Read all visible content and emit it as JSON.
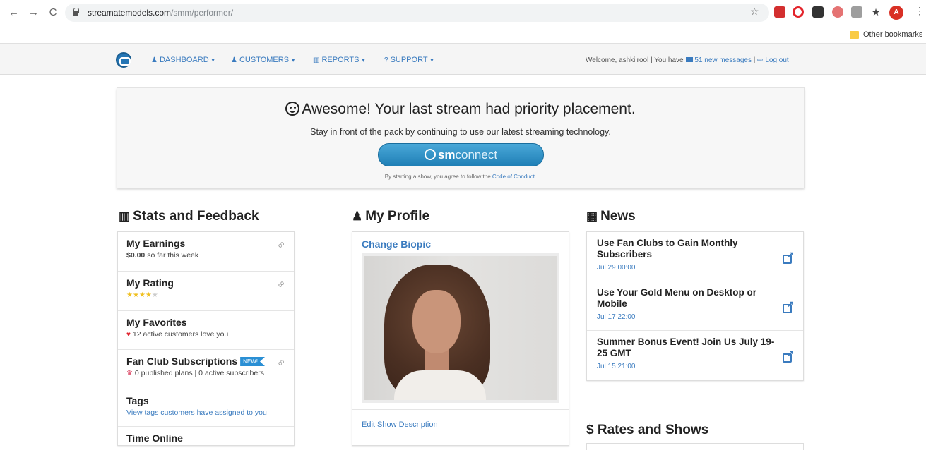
{
  "browser": {
    "url_host": "streamatemodels.com",
    "url_path": "/smm/performer/",
    "bookmarks_label": "Other bookmarks",
    "avatar_letter": "A"
  },
  "navbar": {
    "dashboard": "DASHBOARD",
    "customers": "CUSTOMERS",
    "reports": "REPORTS",
    "support": "SUPPORT",
    "welcome_prefix": "Welcome, ashkiirool | You have",
    "messages": "51 new messages",
    "separator": "|",
    "logout": "Log out"
  },
  "banner": {
    "headline": "Awesome! Your last stream had priority placement.",
    "subtext": "Stay in front of the pack by continuing to use our latest streaming technology.",
    "button_bold": "sm",
    "button_light": "connect",
    "terms_prefix": "By starting a show, you agree to follow the",
    "terms_link": "Code of Conduct",
    "terms_suffix": "."
  },
  "stats": {
    "title": "Stats and Feedback",
    "earnings_title": "My Earnings",
    "earnings_value": "$0.00",
    "earnings_suffix": "so far this week",
    "rating_title": "My Rating",
    "rating_stars": 4,
    "favorites_title": "My Favorites",
    "favorites_text": "12 active customers love you",
    "fanclub_title": "Fan Club Subscriptions",
    "fanclub_badge": "NEW!",
    "fanclub_text": "0 published plans  |  0 active subscribers",
    "tags_title": "Tags",
    "tags_link": "View tags customers have assigned to you",
    "time_title": "Time Online"
  },
  "profile": {
    "title": "My Profile",
    "change_biopic": "Change Biopic",
    "edit_description": "Edit Show Description"
  },
  "news": {
    "title": "News",
    "items": [
      {
        "title": "Use Fan Clubs to Gain Monthly Subscribers",
        "date": "Jul 29 00:00"
      },
      {
        "title": "Use Your Gold Menu on Desktop or Mobile",
        "date": "Jul 17 22:00"
      },
      {
        "title": "Summer Bonus Event! Join Us July 19-25 GMT",
        "date": "Jul 15 21:00"
      }
    ]
  },
  "rates": {
    "title": "Rates and Shows"
  },
  "colors": {
    "link": "#3a7bbf",
    "button": "#2a8fd4",
    "star": "#f0c020",
    "heart": "#e0202a"
  }
}
